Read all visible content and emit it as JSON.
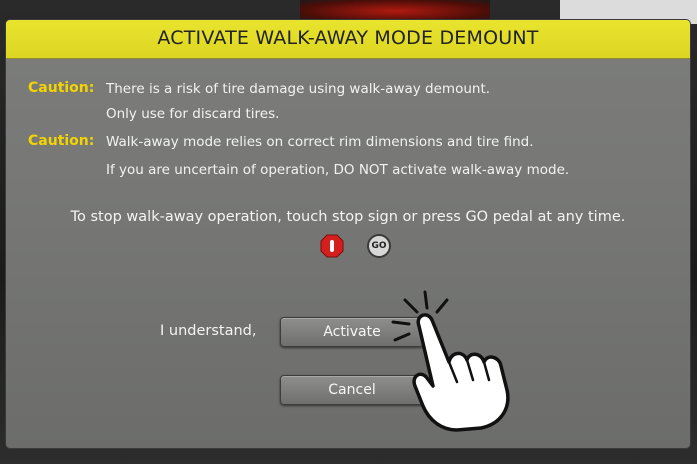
{
  "dialog": {
    "title": "ACTIVATE WALK-AWAY MODE DEMOUNT",
    "caution1": {
      "label": "Caution:",
      "line1": "There is a risk of tire damage using walk-away demount.",
      "line2": "Only use for discard tires."
    },
    "caution2": {
      "label": "Caution:",
      "line1": "Walk-away mode relies on correct rim dimensions and tire find.",
      "line2": "If you are uncertain of operation, DO NOT activate walk-away mode."
    },
    "stop_text": "To stop walk-away operation, touch stop sign or press GO pedal at any time.",
    "go_icon_label": "GO",
    "understand_label": "I understand,",
    "activate_label": "Activate",
    "cancel_label": "Cancel"
  },
  "icons": {
    "stop": "stop-sign-icon",
    "go": "go-pedal-icon",
    "pointer": "pointing-hand-icon"
  },
  "colors": {
    "title_bar": "#e3dd28",
    "caution_label": "#f4d400",
    "stop_sign": "#d51f1f",
    "dialog_bg": "#777876"
  }
}
